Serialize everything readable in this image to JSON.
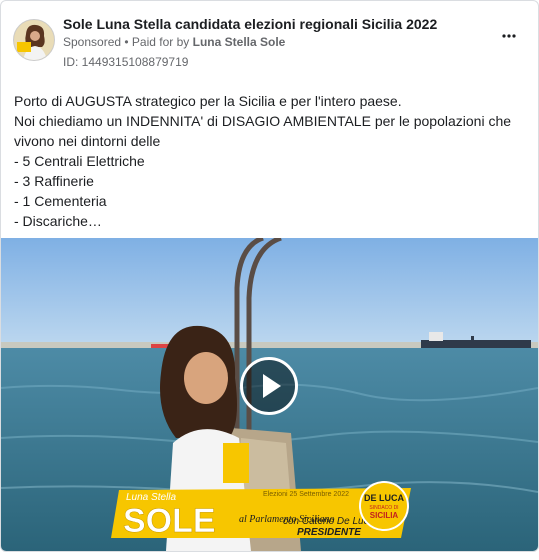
{
  "ad": {
    "page_name": "Sole Luna Stella candidata elezioni regionali Sicilia 2022",
    "sponsored": "Sponsored",
    "paid_for_prefix": "• Paid for by",
    "paid_for_by": "Luna Stella Sole",
    "ad_id": "ID: 1449315108879719",
    "more_icon": "more-options-icon"
  },
  "body": {
    "lines": [
      "Porto di AUGUSTA strategico per la Sicilia e per l'intero paese.",
      "Noi chiediamo un INDENNITA' di DISAGIO AMBIENTALE per le popolazioni che vivono nei dintorni delle",
      "- 5 Centrali Elettriche",
      "- 3 Raffinerie",
      "- 1 Cementeria",
      "- Discariche…"
    ]
  },
  "video": {
    "banner_small_name": "Luna Stella",
    "banner_big_name": "SOLE",
    "banner_script": "al Parlamento Siciliano",
    "banner_with": "con Cateno De Luca",
    "banner_role": "PRESIDENTE",
    "banner_date": "Elezioni 25 Settembre 2022",
    "logo_top": "DE LUCA",
    "logo_mid": "SINDACO DI",
    "logo_bottom": "SICILIA",
    "play_icon": "play-icon"
  },
  "colors": {
    "banner_yellow": "#f7c600",
    "text_primary": "#1c1e21",
    "text_secondary": "#65676b",
    "sky": "#9dc4ea",
    "sea": "#2f6f87"
  }
}
